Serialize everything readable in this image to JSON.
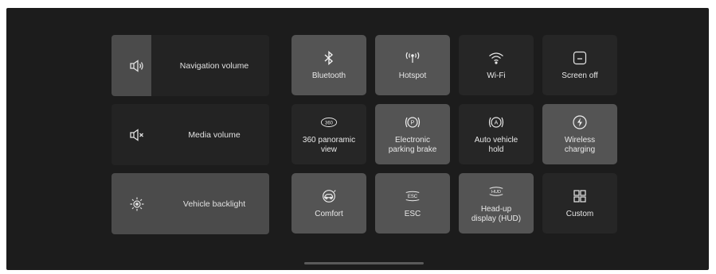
{
  "sliders": [
    {
      "id": "navigation",
      "label": "Navigation volume",
      "icon": "speaker-volume-icon",
      "level": 0.25
    },
    {
      "id": "media",
      "label": "Media volume",
      "icon": "speaker-muted-icon",
      "level": 0.0
    },
    {
      "id": "backlight",
      "label": "Vehicle backlight",
      "icon": "brightness-sun-icon",
      "level": 1.0
    }
  ],
  "tiles": [
    {
      "label": "Bluetooth",
      "icon": "bluetooth-icon",
      "active": true
    },
    {
      "label": "Hotspot",
      "icon": "hotspot-icon",
      "active": true
    },
    {
      "label": "Wi-Fi",
      "icon": "wifi-icon",
      "active": false
    },
    {
      "label": "Screen off",
      "icon": "screen-off-icon",
      "active": false
    },
    {
      "label": "360 panoramic\nview",
      "icon": "360-view-icon",
      "icon_text": "360",
      "active": false
    },
    {
      "label": "Electronic\nparking brake",
      "icon": "parking-brake-icon",
      "icon_text": "P",
      "active": true
    },
    {
      "label": "Auto vehicle\nhold",
      "icon": "auto-hold-icon",
      "icon_text": "A",
      "active": false
    },
    {
      "label": "Wireless\ncharging",
      "icon": "wireless-charging-icon",
      "active": true
    },
    {
      "label": "Comfort",
      "icon": "comfort-mode-icon",
      "active": true
    },
    {
      "label": "ESC",
      "icon": "esc-icon",
      "icon_text": "ESC",
      "active": true
    },
    {
      "label": "Head-up\ndisplay (HUD)",
      "icon": "hud-icon",
      "icon_text": "HUD",
      "active": true
    },
    {
      "label": "Custom",
      "icon": "custom-grid-icon",
      "active": false
    }
  ],
  "colors": {
    "background": "#1c1c1c",
    "tile_off": "#262626",
    "tile_on": "#545454",
    "text": "#e8e8e8"
  }
}
